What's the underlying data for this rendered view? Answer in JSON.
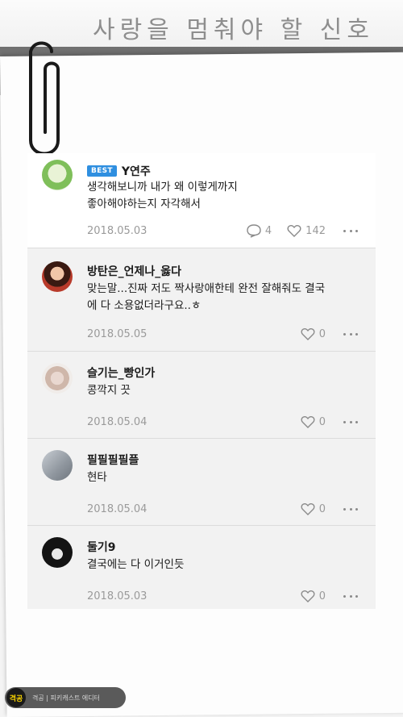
{
  "header": {
    "title": "사랑을 멈춰야 할 신호"
  },
  "comments": [
    {
      "badge": "BEST",
      "username": "Y연주",
      "text_lines": [
        "생각해보니까 내가 왜 이렇게까지",
        "좋아해야하는지 자각해서"
      ],
      "date": "2018.05.03",
      "reply_count": "4",
      "like_count": "142",
      "avatar_icon": "matcha-drink-avatar"
    },
    {
      "username": "방탄은_언제나_옳다",
      "text_lines": [
        "맞는말...진짜 저도 짝사랑애한테 완전 잘해줘도 결국",
        "에 다 소용없더라구요..ㅎ"
      ],
      "date": "2018.05.05",
      "like_count": "0",
      "avatar_icon": "person-red-avatar"
    },
    {
      "username": "슬기는_빵인가",
      "text_lines": [
        "콩깍지 끗"
      ],
      "date": "2018.05.04",
      "like_count": "0",
      "avatar_icon": "person-light-avatar"
    },
    {
      "username": "필필필필플",
      "text_lines": [
        "현타"
      ],
      "date": "2018.05.04",
      "like_count": "0",
      "avatar_icon": "gray-building-avatar"
    },
    {
      "username": "둘기9",
      "text_lines": [
        "결국에는 다 이거인듯"
      ],
      "date": "2018.05.03",
      "like_count": "0",
      "avatar_icon": "white-dove-avatar"
    }
  ],
  "footer": {
    "logo_text": "격공",
    "caption": "격공 | 피키캐스트 에디터"
  },
  "colors": {
    "badge_blue": "#2f8fe0",
    "meta_gray": "#9a9a9a",
    "strip_gray": "#7a7a7a"
  }
}
